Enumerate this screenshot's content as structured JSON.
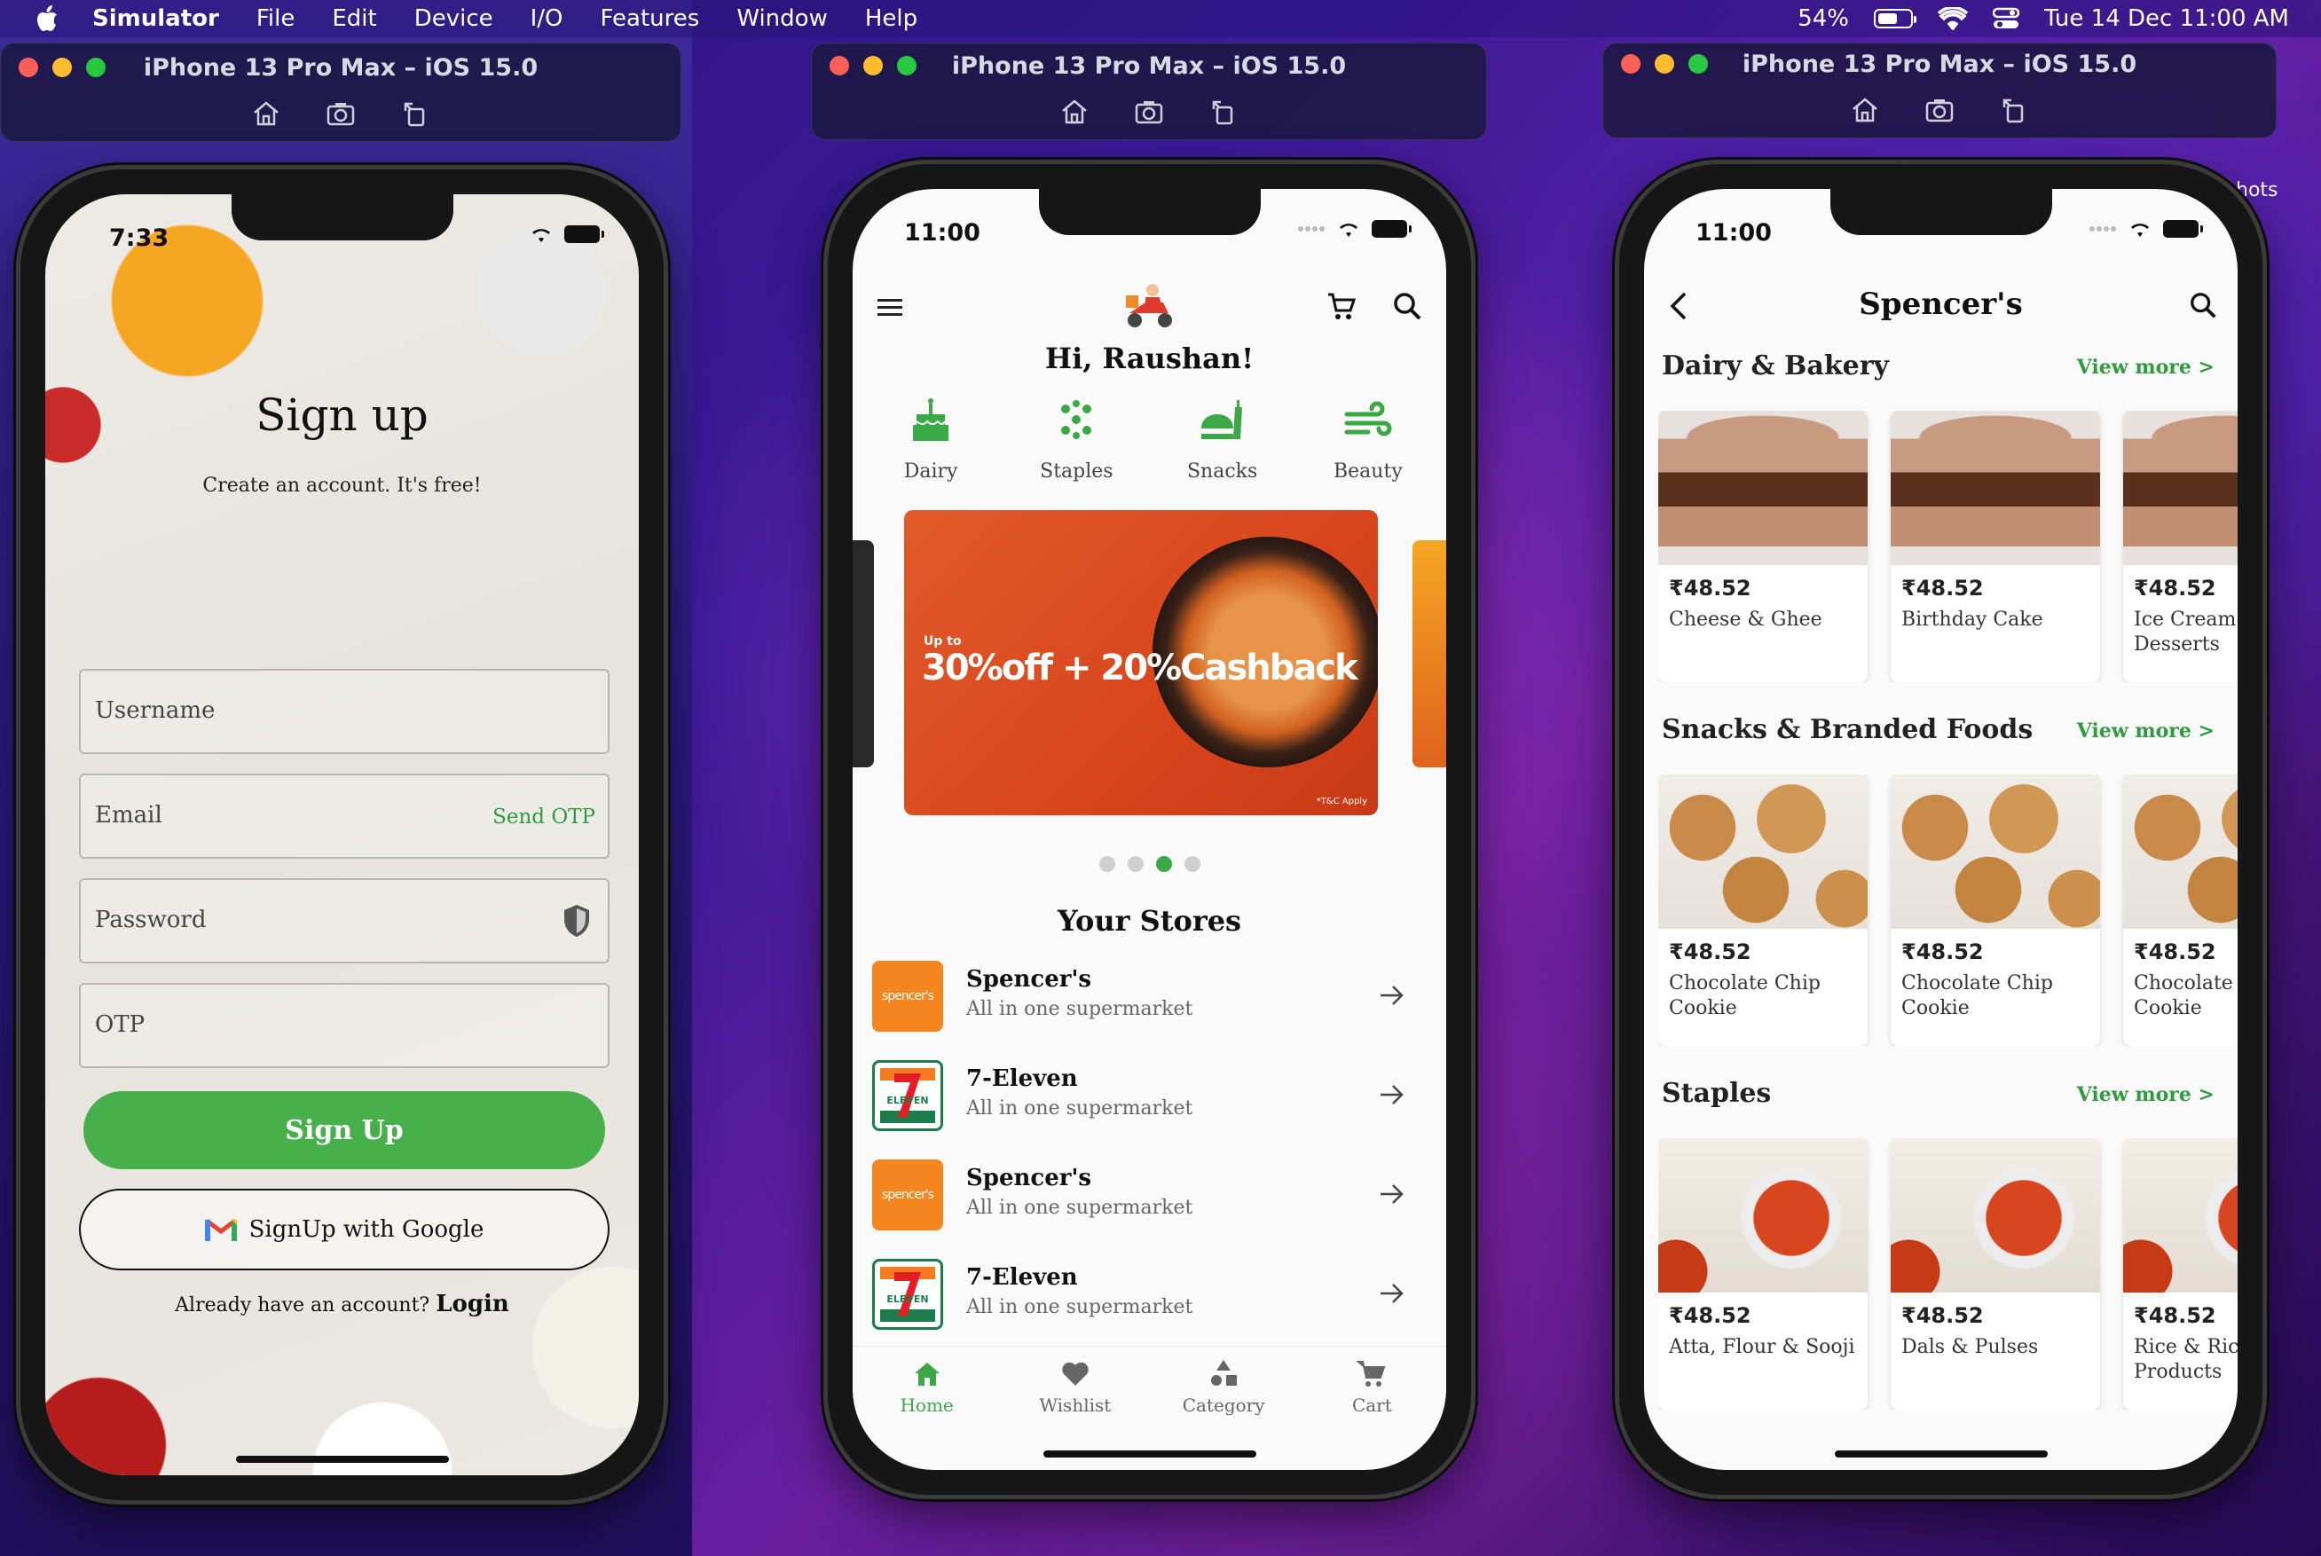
{
  "menubar": {
    "app_name": "Simulator",
    "menus": [
      "File",
      "Edit",
      "Device",
      "I/O",
      "Features",
      "Window",
      "Help"
    ],
    "battery": "54%",
    "datetime": "Tue 14 Dec  11:00 AM"
  },
  "desktop": {
    "partial_label": "hots"
  },
  "simulators": [
    {
      "title": "iPhone 13 Pro Max – iOS 15.0"
    },
    {
      "title": "iPhone 13 Pro Max – iOS 15.0"
    },
    {
      "title": "iPhone 13 Pro Max – iOS 15.0"
    }
  ],
  "signup": {
    "time": "7:33",
    "title": "Sign up",
    "subtitle": "Create an account. It's free!",
    "fields": {
      "username": "Username",
      "email": "Email",
      "password": "Password",
      "otp": "OTP"
    },
    "send_otp": "Send OTP",
    "signup_button": "Sign Up",
    "google_button": "SignUp with Google",
    "already_text": "Already have an account?",
    "login_link": "Login"
  },
  "home": {
    "time": "11:00",
    "greeting": "Hi, Raushan!",
    "categories": [
      "Dairy",
      "Staples",
      "Snacks",
      "Beauty"
    ],
    "banner": {
      "upto": "Up to",
      "offer": "30%off + 20%Cashback",
      "tc": "*T&C Apply"
    },
    "carousel": {
      "count": 4,
      "active": 3
    },
    "stores_title": "Your Stores",
    "stores": [
      {
        "name": "Spencer's",
        "desc": "All in one supermarket",
        "logo": "spencer's"
      },
      {
        "name": "7-Eleven",
        "desc": "All in one supermarket",
        "logo": "ELEVEN"
      },
      {
        "name": "Spencer's",
        "desc": "All in one supermarket",
        "logo": "spencer's"
      },
      {
        "name": "7-Eleven",
        "desc": "All in one supermarket",
        "logo": "ELEVEN"
      }
    ],
    "nav": [
      "Home",
      "Wishlist",
      "Category",
      "Cart"
    ],
    "accent": "#3aa845"
  },
  "store": {
    "time": "11:00",
    "title": "Spencer's",
    "view_more": "View more >",
    "sections": [
      {
        "title": "Dairy & Bakery",
        "products": [
          {
            "price": "₹48.52",
            "name": "Cheese & Ghee"
          },
          {
            "price": "₹48.52",
            "name": "Birthday Cake"
          },
          {
            "price": "₹48.52",
            "name": "Ice Cream & Desserts"
          }
        ]
      },
      {
        "title": "Snacks & Branded Foods",
        "products": [
          {
            "price": "₹48.52",
            "name": "Chocolate Chip Cookie"
          },
          {
            "price": "₹48.52",
            "name": "Chocolate Chip Cookie"
          },
          {
            "price": "₹48.52",
            "name": "Chocolate Chip Cookie"
          }
        ]
      },
      {
        "title": "Staples",
        "products": [
          {
            "price": "₹48.52",
            "name": "Atta, Flour & Sooji"
          },
          {
            "price": "₹48.52",
            "name": "Dals & Pulses"
          },
          {
            "price": "₹48.52",
            "name": "Rice & Rice Products"
          }
        ]
      }
    ]
  }
}
